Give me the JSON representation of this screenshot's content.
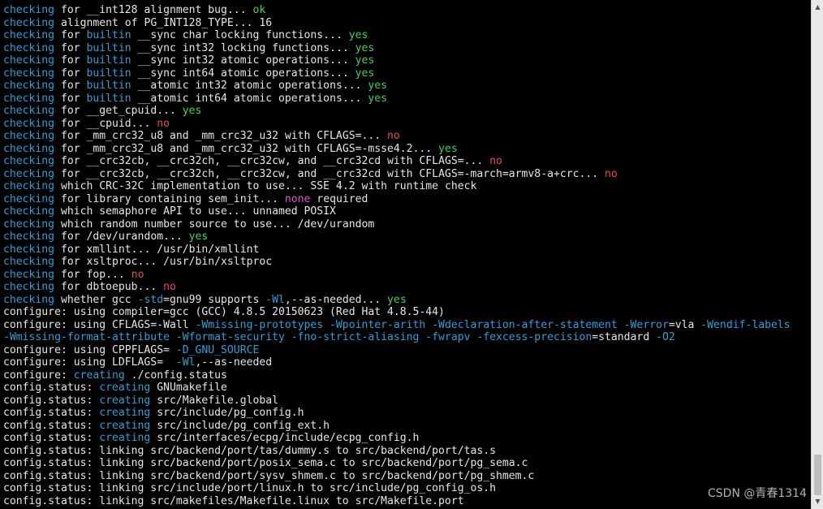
{
  "colors": {
    "background": "#000000",
    "text": "#e6e6e6",
    "keyword_blue": "#2e9fd9",
    "yes_green": "#41d35a",
    "no_red": "#ea4d4d",
    "none_magenta": "#d25ad6"
  },
  "terminal": {
    "lines": [
      [
        [
          "c-blue",
          "checking"
        ],
        [
          "c-white",
          " for __int128 alignment bug... "
        ],
        [
          "c-green",
          "ok"
        ]
      ],
      [
        [
          "c-blue",
          "checking"
        ],
        [
          "c-white",
          " alignment of PG_INT128_TYPE... 16"
        ]
      ],
      [
        [
          "c-blue",
          "checking"
        ],
        [
          "c-white",
          " for "
        ],
        [
          "c-blue",
          "builtin"
        ],
        [
          "c-white",
          " __sync char locking functions... "
        ],
        [
          "c-green",
          "yes"
        ]
      ],
      [
        [
          "c-blue",
          "checking"
        ],
        [
          "c-white",
          " for "
        ],
        [
          "c-blue",
          "builtin"
        ],
        [
          "c-white",
          " __sync int32 locking functions... "
        ],
        [
          "c-green",
          "yes"
        ]
      ],
      [
        [
          "c-blue",
          "checking"
        ],
        [
          "c-white",
          " for "
        ],
        [
          "c-blue",
          "builtin"
        ],
        [
          "c-white",
          " __sync int32 atomic operations... "
        ],
        [
          "c-green",
          "yes"
        ]
      ],
      [
        [
          "c-blue",
          "checking"
        ],
        [
          "c-white",
          " for "
        ],
        [
          "c-blue",
          "builtin"
        ],
        [
          "c-white",
          " __sync int64 atomic operations... "
        ],
        [
          "c-green",
          "yes"
        ]
      ],
      [
        [
          "c-blue",
          "checking"
        ],
        [
          "c-white",
          " for "
        ],
        [
          "c-blue",
          "builtin"
        ],
        [
          "c-white",
          " __atomic int32 atomic operations... "
        ],
        [
          "c-green",
          "yes"
        ]
      ],
      [
        [
          "c-blue",
          "checking"
        ],
        [
          "c-white",
          " for "
        ],
        [
          "c-blue",
          "builtin"
        ],
        [
          "c-white",
          " __atomic int64 atomic operations... "
        ],
        [
          "c-green",
          "yes"
        ]
      ],
      [
        [
          "c-blue",
          "checking"
        ],
        [
          "c-white",
          " for __get_cpuid... "
        ],
        [
          "c-green",
          "yes"
        ]
      ],
      [
        [
          "c-blue",
          "checking"
        ],
        [
          "c-white",
          " for __cpuid... "
        ],
        [
          "c-red",
          "no"
        ]
      ],
      [
        [
          "c-blue",
          "checking"
        ],
        [
          "c-white",
          " for _mm_crc32_u8 and _mm_crc32_u32 with CFLAGS=... "
        ],
        [
          "c-red",
          "no"
        ]
      ],
      [
        [
          "c-blue",
          "checking"
        ],
        [
          "c-white",
          " for _mm_crc32_u8 and _mm_crc32_u32 with CFLAGS=-msse4.2... "
        ],
        [
          "c-green",
          "yes"
        ]
      ],
      [
        [
          "c-blue",
          "checking"
        ],
        [
          "c-white",
          " for __crc32cb, __crc32ch, __crc32cw, and __crc32cd with CFLAGS=... "
        ],
        [
          "c-red",
          "no"
        ]
      ],
      [
        [
          "c-blue",
          "checking"
        ],
        [
          "c-white",
          " for __crc32cb, __crc32ch, __crc32cw, and __crc32cd with CFLAGS=-march=armv8-a+crc... "
        ],
        [
          "c-red",
          "no"
        ]
      ],
      [
        [
          "c-blue",
          "checking"
        ],
        [
          "c-white",
          " which CRC-32C implementation to use... SSE 4.2 with runtime check"
        ]
      ],
      [
        [
          "c-blue",
          "checking"
        ],
        [
          "c-white",
          " for library containing sem_init... "
        ],
        [
          "c-magenta",
          "none"
        ],
        [
          "c-white",
          " required"
        ]
      ],
      [
        [
          "c-blue",
          "checking"
        ],
        [
          "c-white",
          " which semaphore API to use... unnamed POSIX"
        ]
      ],
      [
        [
          "c-blue",
          "checking"
        ],
        [
          "c-white",
          " which random number source to use... /dev/urandom"
        ]
      ],
      [
        [
          "c-blue",
          "checking"
        ],
        [
          "c-white",
          " for /dev/urandom... "
        ],
        [
          "c-green",
          "yes"
        ]
      ],
      [
        [
          "c-blue",
          "checking"
        ],
        [
          "c-white",
          " for xmllint... /usr/bin/xmllint"
        ]
      ],
      [
        [
          "c-blue",
          "checking"
        ],
        [
          "c-white",
          " for xsltproc... /usr/bin/xsltproc"
        ]
      ],
      [
        [
          "c-blue",
          "checking"
        ],
        [
          "c-white",
          " for fop... "
        ],
        [
          "c-red",
          "no"
        ]
      ],
      [
        [
          "c-blue",
          "checking"
        ],
        [
          "c-white",
          " for dbtoepub... "
        ],
        [
          "c-red",
          "no"
        ]
      ],
      [
        [
          "c-blue",
          "checking"
        ],
        [
          "c-white",
          " whether gcc "
        ],
        [
          "c-blue",
          "-std"
        ],
        [
          "c-white",
          "=gnu99 supports "
        ],
        [
          "c-blue",
          "-Wl"
        ],
        [
          "c-white",
          ",--as-needed... "
        ],
        [
          "c-green",
          "yes"
        ]
      ],
      [
        [
          "c-white",
          "configure: using compiler=gcc (GCC) 4.8.5 20150623 (Red Hat 4.8.5-44)"
        ]
      ],
      [
        [
          "c-white",
          "configure: using CFLAGS=-Wall "
        ],
        [
          "c-blue",
          "-Wmissing-prototypes -Wpointer-arith -Wdeclaration-after-statement -Werror"
        ],
        [
          "c-white",
          "=vla "
        ],
        [
          "c-blue",
          "-Wendif-labels"
        ]
      ],
      [
        [
          "c-blue",
          "-Wmissing-format-attribute -Wformat-security -fno-strict-aliasing -fwrapv -fexcess-precision"
        ],
        [
          "c-white",
          "=standard "
        ],
        [
          "c-blue",
          "-O2"
        ]
      ],
      [
        [
          "c-white",
          "configure: using CPPFLAGS= "
        ],
        [
          "c-blue",
          "-D_GNU_SOURCE"
        ]
      ],
      [
        [
          "c-white",
          "configure: using LDFLAGS=  "
        ],
        [
          "c-blue",
          "-Wl"
        ],
        [
          "c-white",
          ",--as-needed"
        ]
      ],
      [
        [
          "c-white",
          "configure: "
        ],
        [
          "c-blue",
          "creating"
        ],
        [
          "c-white",
          " ./config.status"
        ]
      ],
      [
        [
          "c-white",
          "config.status: "
        ],
        [
          "c-blue",
          "creating"
        ],
        [
          "c-white",
          " GNUmakefile"
        ]
      ],
      [
        [
          "c-white",
          "config.status: "
        ],
        [
          "c-blue",
          "creating"
        ],
        [
          "c-white",
          " src/Makefile.global"
        ]
      ],
      [
        [
          "c-white",
          "config.status: "
        ],
        [
          "c-blue",
          "creating"
        ],
        [
          "c-white",
          " src/include/pg_config.h"
        ]
      ],
      [
        [
          "c-white",
          "config.status: "
        ],
        [
          "c-blue",
          "creating"
        ],
        [
          "c-white",
          " src/include/pg_config_ext.h"
        ]
      ],
      [
        [
          "c-white",
          "config.status: "
        ],
        [
          "c-blue",
          "creating"
        ],
        [
          "c-white",
          " src/interfaces/ecpg/include/ecpg_config.h"
        ]
      ],
      [
        [
          "c-white",
          "config.status: linking src/backend/port/tas/dummy.s to src/backend/port/tas.s"
        ]
      ],
      [
        [
          "c-white",
          "config.status: linking src/backend/port/posix_sema.c to src/backend/port/pg_sema.c"
        ]
      ],
      [
        [
          "c-white",
          "config.status: linking src/backend/port/sysv_shmem.c to src/backend/port/pg_shmem.c"
        ]
      ],
      [
        [
          "c-white",
          "config.status: linking src/include/port/linux.h to src/include/pg_config_os.h"
        ]
      ],
      [
        [
          "c-white",
          "config.status: linking src/makefiles/Makefile.linux to src/Makefile.port"
        ]
      ]
    ]
  },
  "scrollbar": {
    "up_icon": "▲",
    "down_icon": "▼"
  },
  "watermark": {
    "text": "CSDN @青春1314"
  }
}
